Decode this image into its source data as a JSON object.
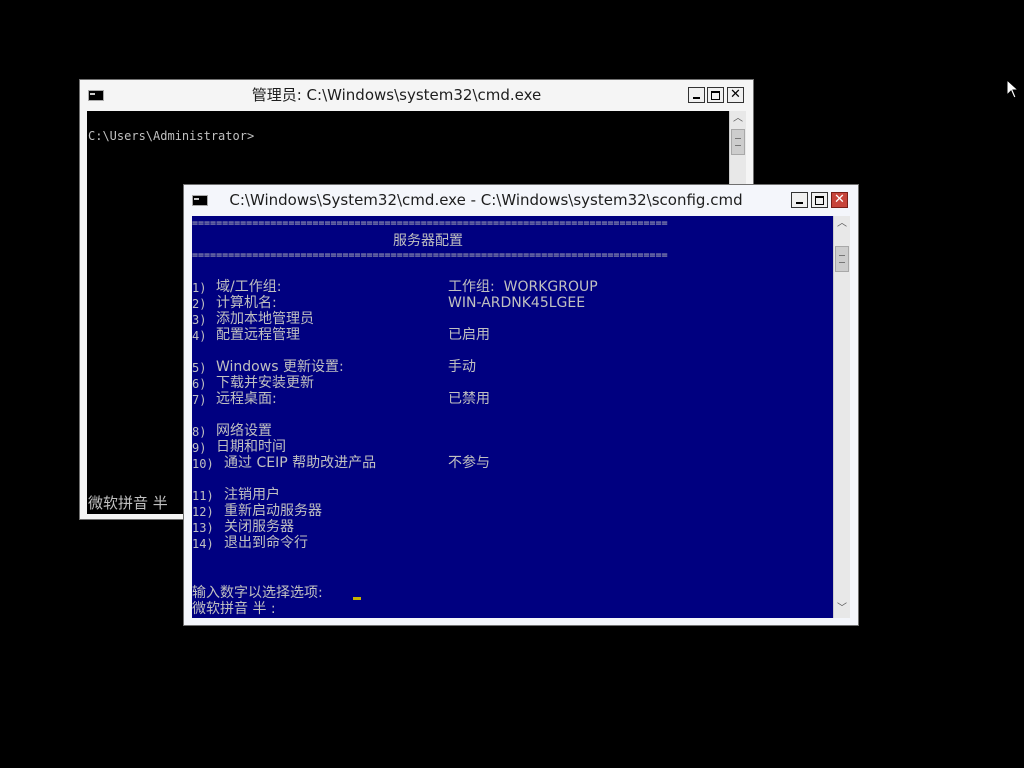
{
  "back_window": {
    "title": "管理员: C:\\Windows\\system32\\cmd.exe",
    "prompt": "C:\\Users\\Administrator>",
    "ime_status": "微软拼音 半"
  },
  "front_window": {
    "title": "C:\\Windows\\System32\\cmd.exe - C:\\Windows\\system32\\sconfig.cmd",
    "separator": "===============================================================================",
    "header": "服务器配置",
    "menu": [
      {
        "num": "1)",
        "label": "域/工作组:",
        "value": "工作组:  WORKGROUP"
      },
      {
        "num": "2)",
        "label": "计算机名:",
        "value": "WIN-ARDNK45LGEE"
      },
      {
        "num": "3)",
        "label": "添加本地管理员",
        "value": ""
      },
      {
        "num": "4)",
        "label": "配置远程管理",
        "value": "已启用"
      },
      {
        "num": "5)",
        "label": "Windows 更新设置:",
        "value": "手动"
      },
      {
        "num": "6)",
        "label": "下载并安装更新",
        "value": ""
      },
      {
        "num": "7)",
        "label": "远程桌面:",
        "value": "已禁用"
      },
      {
        "num": "8)",
        "label": "网络设置",
        "value": ""
      },
      {
        "num": "9)",
        "label": "日期和时间",
        "value": ""
      },
      {
        "num": "10)",
        "label": "通过 CEIP 帮助改进产品",
        "value": "不参与"
      },
      {
        "num": "11)",
        "label": "注销用户",
        "value": ""
      },
      {
        "num": "12)",
        "label": "重新启动服务器",
        "value": ""
      },
      {
        "num": "13)",
        "label": "关闭服务器",
        "value": ""
      },
      {
        "num": "14)",
        "label": "退出到命令行",
        "value": ""
      }
    ],
    "input_prompt": "输入数字以选择选项:",
    "ime_status": "微软拼音 半 :"
  },
  "controls": {
    "minimize": "minimize",
    "maximize": "maximize",
    "close": "✕"
  },
  "colors": {
    "console_blue": "#000080",
    "console_text": "#c0c0c0",
    "cursor": "#c8b400",
    "title_bg": "#ffffff",
    "close_red": "#c7443b"
  }
}
